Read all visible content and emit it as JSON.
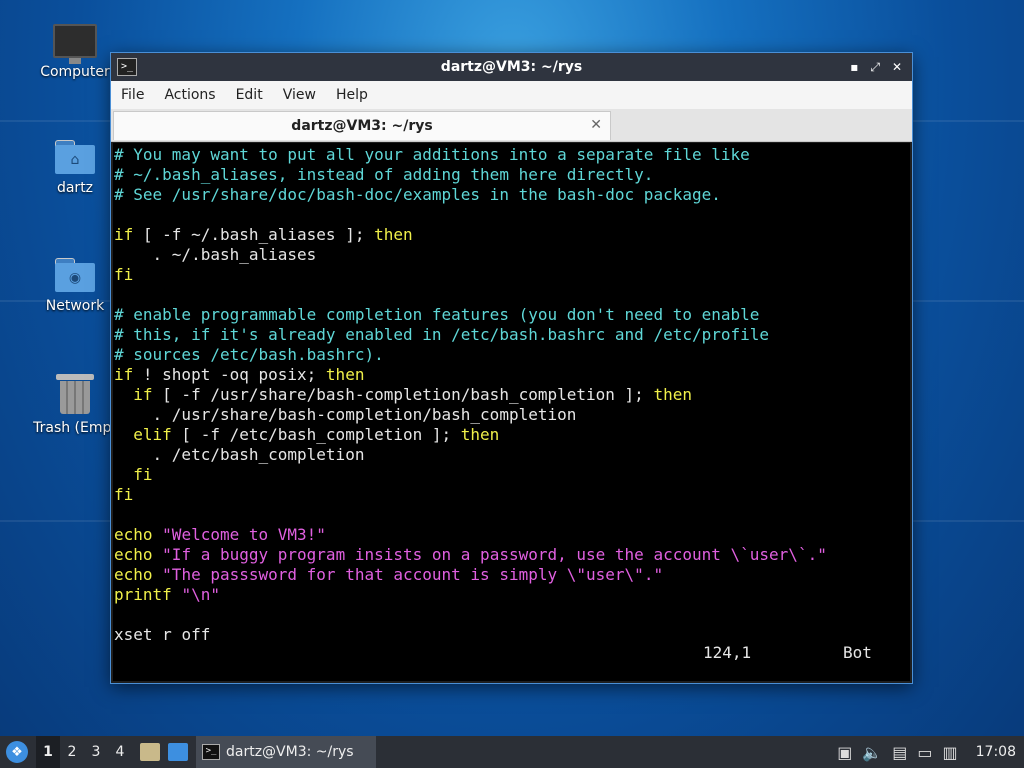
{
  "desktop": {
    "icons": [
      {
        "label": "Computer"
      },
      {
        "label": "dartz"
      },
      {
        "label": "Network"
      },
      {
        "label": "Trash (Empt"
      }
    ]
  },
  "window": {
    "title": "dartz@VM3: ~/rys",
    "controls": {
      "minimize": "▪",
      "restore": "⤢",
      "close": "✕"
    },
    "menu": [
      "File",
      "Actions",
      "Edit",
      "View",
      "Help"
    ],
    "tab": {
      "label": "dartz@VM3: ~/rys",
      "close": "✕"
    }
  },
  "terminal": {
    "lines": [
      [
        {
          "t": "# You may want to put all your additions into a separate file like",
          "c": "comment"
        }
      ],
      [
        {
          "t": "# ~/.bash_aliases, instead of adding them here directly.",
          "c": "comment"
        }
      ],
      [
        {
          "t": "# See /usr/share/doc/bash-doc/examples in the bash-doc package.",
          "c": "comment"
        }
      ],
      [
        {
          "t": "",
          "c": "plain"
        }
      ],
      [
        {
          "t": "if",
          "c": "kw"
        },
        {
          "t": " [ -f ~/.bash_aliases ]; ",
          "c": "plain"
        },
        {
          "t": "then",
          "c": "kw"
        }
      ],
      [
        {
          "t": "    . ~/.bash_aliases",
          "c": "plain"
        }
      ],
      [
        {
          "t": "fi",
          "c": "kw"
        }
      ],
      [
        {
          "t": "",
          "c": "plain"
        }
      ],
      [
        {
          "t": "# enable programmable completion features (you don't need to enable",
          "c": "comment"
        }
      ],
      [
        {
          "t": "# this, if it's already enabled in /etc/bash.bashrc and /etc/profile",
          "c": "comment"
        }
      ],
      [
        {
          "t": "# sources /etc/bash.bashrc).",
          "c": "comment"
        }
      ],
      [
        {
          "t": "if",
          "c": "kw"
        },
        {
          "t": " ! shopt -oq posix; ",
          "c": "plain"
        },
        {
          "t": "then",
          "c": "kw"
        }
      ],
      [
        {
          "t": "  if",
          "c": "kw"
        },
        {
          "t": " [ -f /usr/share/bash-completion/bash_completion ]; ",
          "c": "plain"
        },
        {
          "t": "then",
          "c": "kw"
        }
      ],
      [
        {
          "t": "    . /usr/share/bash-completion/bash_completion",
          "c": "plain"
        }
      ],
      [
        {
          "t": "  elif",
          "c": "kw"
        },
        {
          "t": " [ -f /etc/bash_completion ]; ",
          "c": "plain"
        },
        {
          "t": "then",
          "c": "kw"
        }
      ],
      [
        {
          "t": "    . /etc/bash_completion",
          "c": "plain"
        }
      ],
      [
        {
          "t": "  fi",
          "c": "kw"
        }
      ],
      [
        {
          "t": "fi",
          "c": "kw"
        }
      ],
      [
        {
          "t": "",
          "c": "plain"
        }
      ],
      [
        {
          "t": "echo",
          "c": "kw"
        },
        {
          "t": " ",
          "c": "plain"
        },
        {
          "t": "\"Welcome to VM3!\"",
          "c": "str"
        }
      ],
      [
        {
          "t": "echo",
          "c": "kw"
        },
        {
          "t": " ",
          "c": "plain"
        },
        {
          "t": "\"If a buggy program insists on a password, use the account \\`user\\`.\"",
          "c": "str"
        }
      ],
      [
        {
          "t": "echo",
          "c": "kw"
        },
        {
          "t": " ",
          "c": "plain"
        },
        {
          "t": "\"The passsword for that account is simply \\\"user\\\".\"",
          "c": "str"
        }
      ],
      [
        {
          "t": "printf",
          "c": "kw"
        },
        {
          "t": " ",
          "c": "plain"
        },
        {
          "t": "\"\\n\"",
          "c": "str"
        }
      ],
      [
        {
          "t": "",
          "c": "plain"
        }
      ],
      [
        {
          "t": "x",
          "c": "cursor"
        },
        {
          "t": "set r off",
          "c": "plain"
        }
      ]
    ],
    "status": {
      "position": "124,1",
      "scroll": "Bot"
    }
  },
  "taskbar": {
    "workspaces": [
      "1",
      "2",
      "3",
      "4"
    ],
    "active_workspace": "1",
    "task_label": "dartz@VM3: ~/rys",
    "clock": "17:08"
  }
}
